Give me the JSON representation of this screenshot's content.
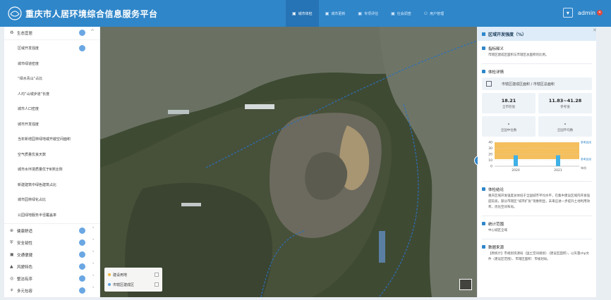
{
  "header": {
    "title": "重庆市人居环境综合信息服务平台",
    "nav": [
      {
        "label": "城市体检",
        "active": true
      },
      {
        "label": "城市更新",
        "active": false
      },
      {
        "label": "专项评估",
        "active": false
      },
      {
        "label": "社会调查",
        "active": false
      },
      {
        "label": "用户管理",
        "active": false
      }
    ],
    "user": "admin",
    "user_badge": "✕"
  },
  "sidebar": {
    "groups": [
      {
        "label": "生态宜居",
        "icon": "leaf-icon",
        "glyph": "♻",
        "expanded": true
      },
      {
        "label": "健康舒适",
        "icon": "health-icon",
        "glyph": "⊕"
      },
      {
        "label": "安全韧性",
        "icon": "shield-icon",
        "glyph": "⛨"
      },
      {
        "label": "交通便捷",
        "icon": "car-icon",
        "glyph": "▣"
      },
      {
        "label": "风貌特色",
        "icon": "landscape-icon",
        "glyph": "▲"
      },
      {
        "label": "整洁有序",
        "icon": "broom-icon",
        "glyph": "◎"
      },
      {
        "label": "多元包容",
        "icon": "people-icon",
        "glyph": "⚘"
      }
    ],
    "sub_items": [
      "区域开发强度",
      "城市绿道密度",
      "“绿水青山”占比",
      "人均“山城步道”长度",
      "城市人口密度",
      "城市开发强度",
      "当年新增园林绿地或开敞空间面积",
      "空气质量优良天数",
      "城市水环境质量优于Ⅲ类比例",
      "新建建筑中绿色建筑占比",
      "城市园林绿化占比",
      "公园绿地服务半径覆盖率"
    ]
  },
  "map": {
    "legend": [
      {
        "label": "建设用地",
        "color": "#f0b73c"
      },
      {
        "label": "市辖区建成区",
        "color": "#5aa0e6"
      }
    ]
  },
  "panel": {
    "title": "区域开发强度（%）",
    "definition_title": "指标释义",
    "definition": "市辖区建成区面积与市辖区总面积的比例。",
    "detail_title": "体检详情",
    "formula": "市辖区建成区面积 / 市辖区总面积",
    "stats": [
      {
        "value": "18.21",
        "label": "全市检值"
      },
      {
        "value": "11.83~41.28",
        "label": "参考值"
      },
      {
        "value": "-",
        "label": "全国中位数"
      },
      {
        "value": "-",
        "label": "全国平均数"
      }
    ],
    "analysis_title": "体检结论",
    "analysis": "重庆区域开发强度总体低于全国城市平均水平，在集中建设区域内开发强度较高，部分市辖区“城市扩张”现象明显，未来应进一步提升土地利用效率，优化空间布局。",
    "scope_title": "统计范围",
    "scope": "中心城区全域",
    "source_title": "数据来源",
    "source": "【原统计】市规划资源局（国土空间规划）（建设区面积），以矢量shp文件（建设区范围）、市辖区面积：市规划局。"
  },
  "chart_data": {
    "type": "bar",
    "categories": [
      "2020",
      "2021"
    ],
    "series": [
      {
        "name": "参考区间",
        "values": [
          41.28,
          41.28
        ],
        "low": [
          11.83,
          11.83
        ],
        "kind": "band"
      },
      {
        "name": "参考区间",
        "values": [
          18.21,
          18.21
        ],
        "kind": "bar"
      }
    ],
    "y_ticks": [
      "40",
      "30",
      "20",
      "10",
      "0"
    ],
    "ylim": [
      0,
      40
    ],
    "xlabel": "年份",
    "band_color": "#f3b84a",
    "bar_color": "#3fb1e6"
  }
}
